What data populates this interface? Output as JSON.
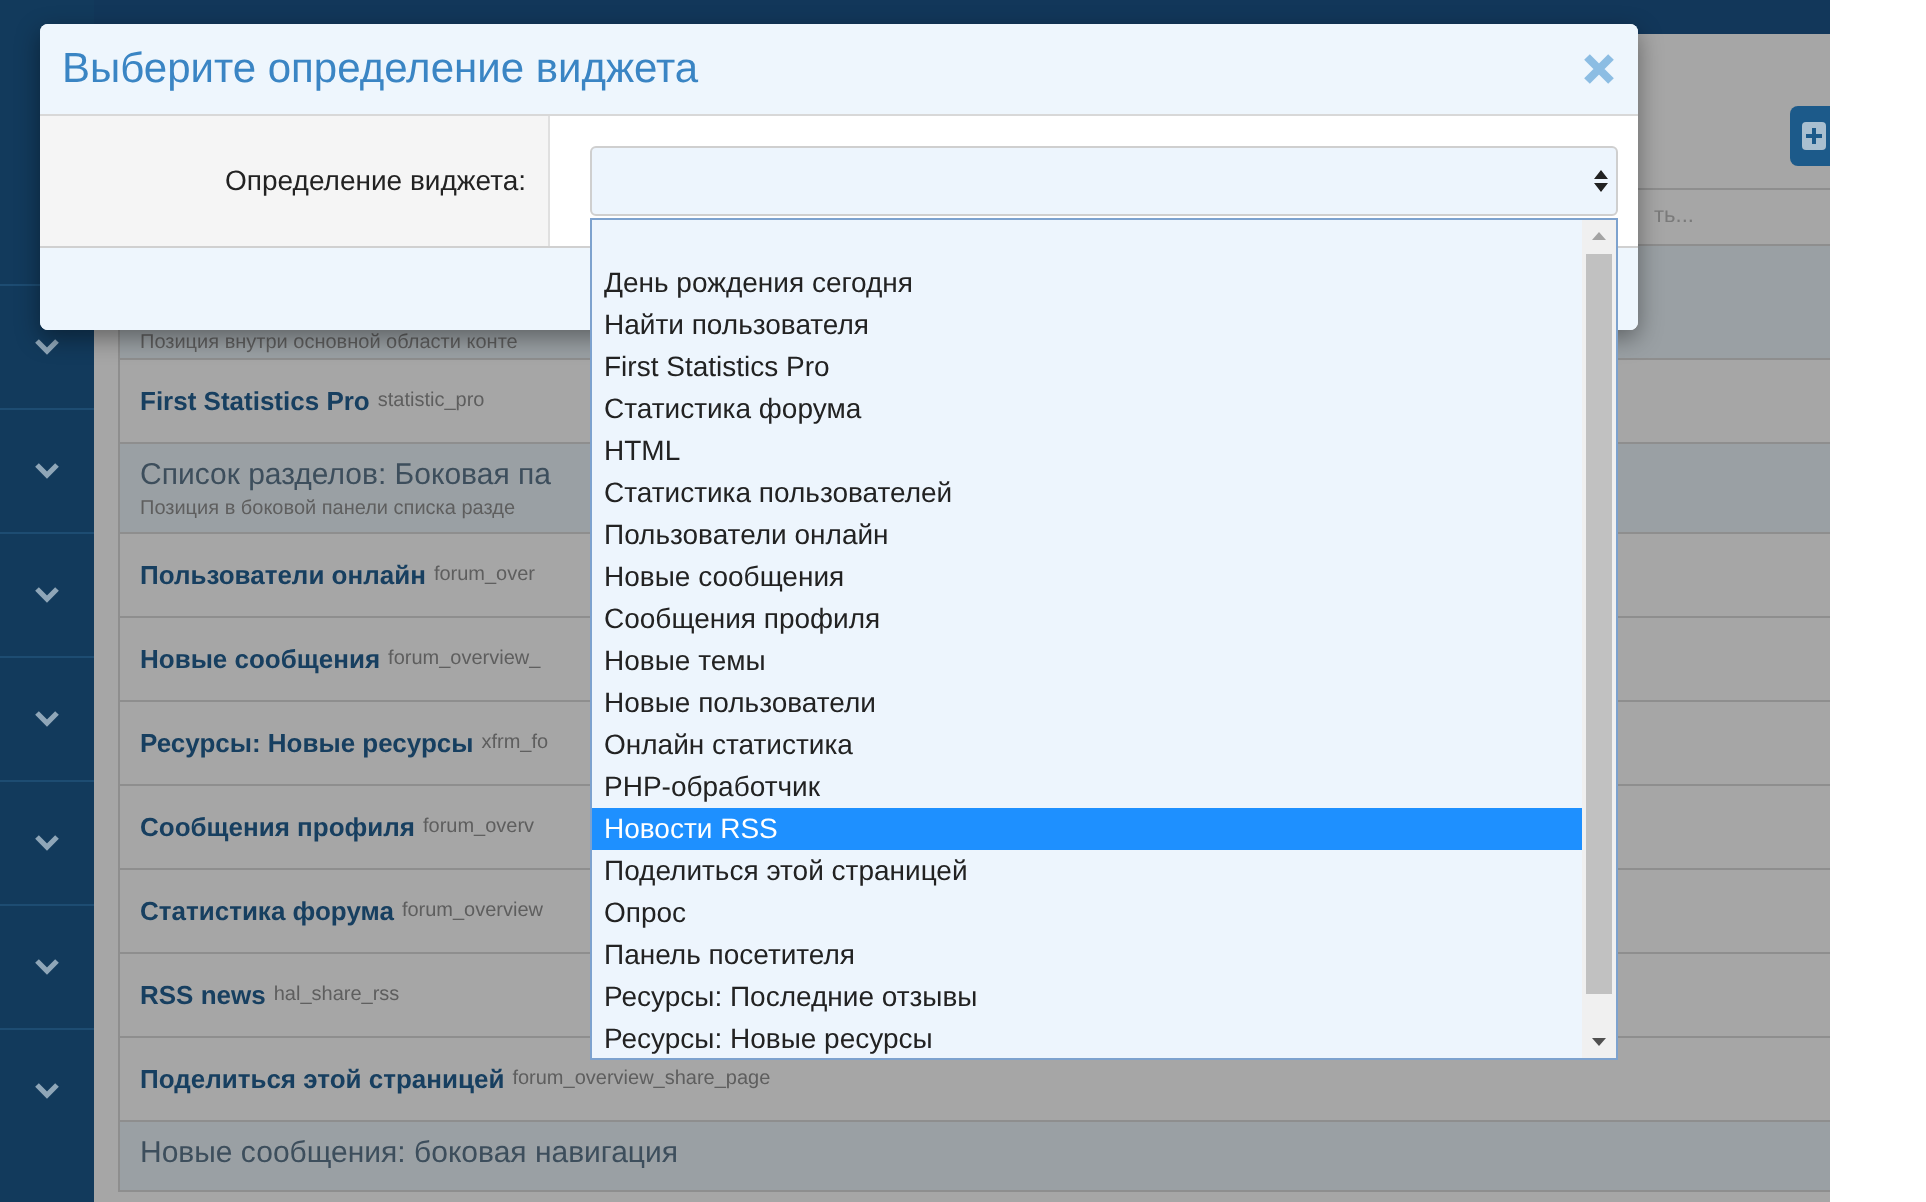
{
  "background": {
    "filter_hint": "ть...",
    "rows": [
      {
        "kind": "description",
        "text": "Позиция внутри основной области конте"
      },
      {
        "kind": "widget",
        "title": "First Statistics Pro",
        "code": "statistic_pro"
      },
      {
        "kind": "position",
        "title": "Список разделов: Боковая па",
        "text": "Позиция в боковой панели списка разде"
      },
      {
        "kind": "widget",
        "title": "Пользователи онлайн",
        "code": "forum_over"
      },
      {
        "kind": "widget",
        "title": "Новые сообщения",
        "code": "forum_overview_"
      },
      {
        "kind": "widget",
        "title": "Ресурсы: Новые ресурсы",
        "code": "xfrm_fo"
      },
      {
        "kind": "widget",
        "title": "Сообщения профиля",
        "code": "forum_overv"
      },
      {
        "kind": "widget",
        "title": "Статистика форума",
        "code": "forum_overview"
      },
      {
        "kind": "widget",
        "title": "RSS news",
        "code": "hal_share_rss"
      },
      {
        "kind": "widget",
        "title": "Поделиться этой страницей",
        "code": "forum_overview_share_page"
      },
      {
        "kind": "position",
        "title": "Новые сообщения: боковая навигация"
      }
    ]
  },
  "dialog": {
    "title": "Выберите определение виджета",
    "field_label": "Определение виджета:",
    "options": [
      {
        "label": "День рождения сегодня",
        "selected": false
      },
      {
        "label": "Найти пользователя",
        "selected": false
      },
      {
        "label": "First Statistics Pro",
        "selected": false
      },
      {
        "label": "Статистика форума",
        "selected": false
      },
      {
        "label": "HTML",
        "selected": false
      },
      {
        "label": "Статистика пользователей",
        "selected": false
      },
      {
        "label": "Пользователи онлайн",
        "selected": false
      },
      {
        "label": "Новые сообщения",
        "selected": false
      },
      {
        "label": "Сообщения профиля",
        "selected": false
      },
      {
        "label": "Новые темы",
        "selected": false
      },
      {
        "label": "Новые пользователи",
        "selected": false
      },
      {
        "label": "Онлайн статистика",
        "selected": false
      },
      {
        "label": "PHP-обработчик",
        "selected": false
      },
      {
        "label": "Новости RSS",
        "selected": true
      },
      {
        "label": "Поделиться этой страницей",
        "selected": false
      },
      {
        "label": "Опрос",
        "selected": false
      },
      {
        "label": "Панель посетителя",
        "selected": false
      },
      {
        "label": "Ресурсы: Последние отзывы",
        "selected": false
      },
      {
        "label": "Ресурсы: Новые ресурсы",
        "selected": false
      }
    ]
  }
}
